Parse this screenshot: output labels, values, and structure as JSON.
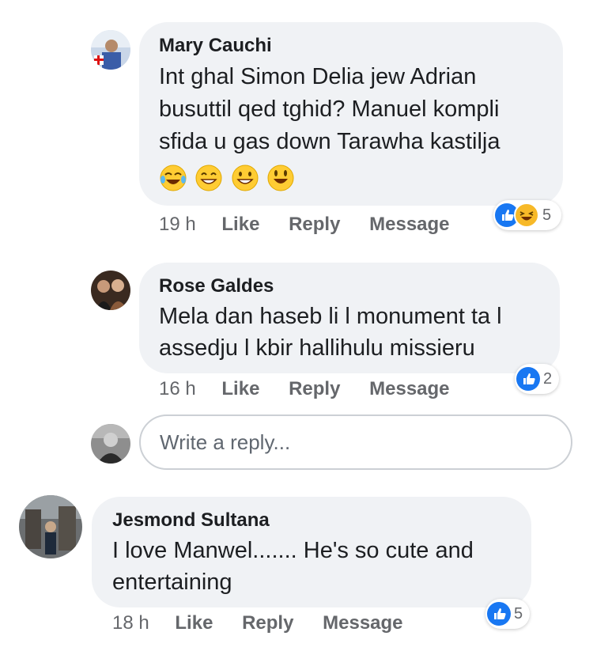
{
  "comments": [
    {
      "author": "Mary Cauchi",
      "line1": "Int ghal Simon Delia jew Adrian",
      "line2": "busuttil qed tghid? Manuel kompli",
      "line3": "sfida u gas down Tarawha kastilja",
      "time": "19 h",
      "like": "Like",
      "reply": "Reply",
      "message": "Message",
      "reaction_count": "5"
    },
    {
      "author": "Rose Galdes",
      "line1": "Mela dan haseb li l monument ta l",
      "line2": "assedju l kbir hallihulu missieru",
      "time": "16 h",
      "like": "Like",
      "reply": "Reply",
      "message": "Message",
      "reaction_count": "2"
    },
    {
      "author": "Jesmond Sultana",
      "line1": "I love Manwel....... He's so cute and",
      "line2": "entertaining",
      "time": "18 h",
      "like": "Like",
      "reply": "Reply",
      "message": "Message",
      "reaction_count": "5"
    }
  ],
  "reply_box": {
    "placeholder": "Write a reply..."
  },
  "colors": {
    "bubble": "#f0f2f5",
    "like_blue": "#1877f2",
    "haha_yellow": "#f7b928",
    "meta_gray": "#65676b"
  }
}
